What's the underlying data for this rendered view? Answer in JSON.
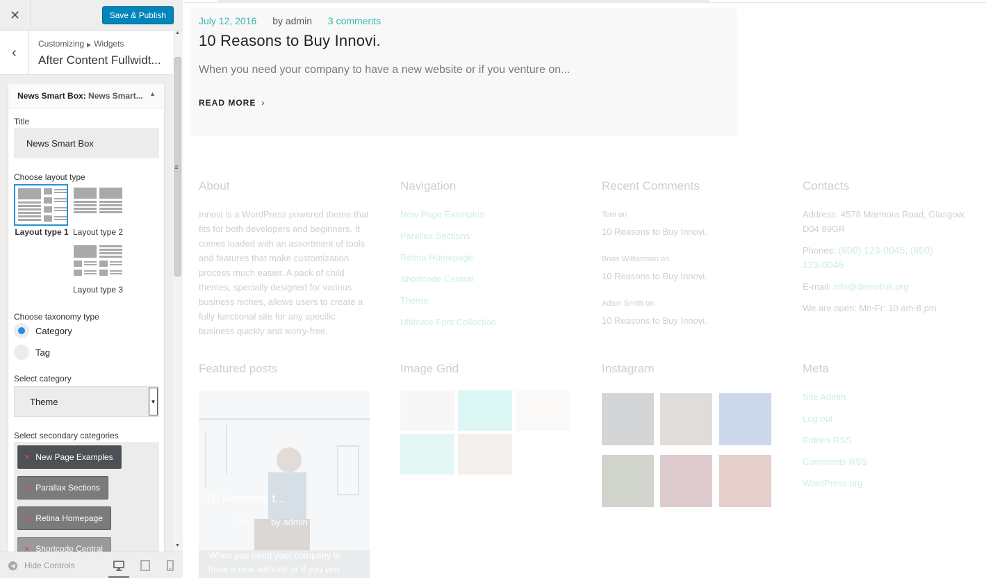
{
  "header": {
    "save_label": "Save & Publish"
  },
  "section": {
    "breadcrumb_root": "Customizing",
    "breadcrumb_parent": "Widgets",
    "title": "After Content Fullwidt..."
  },
  "widget": {
    "name": "News Smart Box:",
    "name_sub": "News Smart...",
    "title_label": "Title",
    "title_value": "News Smart Box",
    "layout_label": "Choose layout type",
    "layouts": [
      {
        "label": "Layout type 1",
        "selected": true
      },
      {
        "label": "Layout type 2",
        "selected": false
      },
      {
        "label": "Layout type 3",
        "selected": false
      }
    ],
    "taxonomy_label": "Choose taxonomy type",
    "taxonomy_options": [
      {
        "label": "Category",
        "checked": true
      },
      {
        "label": "Tag",
        "checked": false
      }
    ],
    "category_label": "Select category",
    "category_value": "Theme",
    "secondary_label": "Select secondary categories",
    "secondary_chips": [
      "New Page Examples",
      "Parallax Sections",
      "Retina Homepage",
      "Shortcode Central"
    ]
  },
  "footer": {
    "hide_controls": "Hide Controls"
  },
  "post": {
    "date": "July 12, 2016",
    "author": "by admin",
    "comments": "3 comments",
    "title": "10 Reasons to Buy Innovi.",
    "excerpt": "When you need your company to have a new website or if you venture on...",
    "read_more": "READ MORE"
  },
  "about": {
    "title": "About",
    "text": "Innovi is a WordPress powered theme that fits for both developers and beginners. It comes loaded with an assortment of tools and features that make customization process much easier. A pack of child themes, specially designed for various business niches, allows users to create a fully functional site for any specific business quickly and worry-free."
  },
  "navigation": {
    "title": "Navigation",
    "links": [
      "New Page Examples",
      "Parallax Sections",
      "Retina Homepage",
      "Shortcode Central",
      "Theme",
      "Ultimate Font Collection"
    ]
  },
  "recent_comments": {
    "title": "Recent Comments",
    "items": [
      {
        "author": "Tom",
        "on": "on",
        "post": "10 Reasons to Buy Innovi."
      },
      {
        "author": "Brian Williamson",
        "on": "on",
        "post": "10 Reasons to Buy Innovi."
      },
      {
        "author": "Adam Smith",
        "on": "on",
        "post": "10 Reasons to Buy Innovi."
      }
    ]
  },
  "contacts": {
    "title": "Contacts",
    "address": "Address: 4578 Marmora Road, Glasgow, D04 89GR",
    "phones_label": "Phones:",
    "phone1": "(800) 123-0045",
    "phone2": "(800) 123-0046",
    "email_label": "E-mail:",
    "email": "info@demolink.org",
    "hours": "We are open: Mn-Fr: 10 am-8 pm"
  },
  "featured": {
    "title": "Featured posts",
    "post_title": "10 Reasons t...",
    "post_date": "20",
    "post_author": "by admin",
    "post_excerpt": "When you need your company to have a new website or if you ven..."
  },
  "image_grid": {
    "title": "Image Grid"
  },
  "instagram": {
    "title": "Instagram"
  },
  "meta": {
    "title": "Meta",
    "links": [
      "Site Admin",
      "Log out",
      "Entries RSS",
      "Comments RSS",
      "WordPress.org"
    ]
  },
  "colors": {
    "accent": "#0085ba",
    "teal": "#38b7b3",
    "radio_on": "#1e8cea"
  }
}
